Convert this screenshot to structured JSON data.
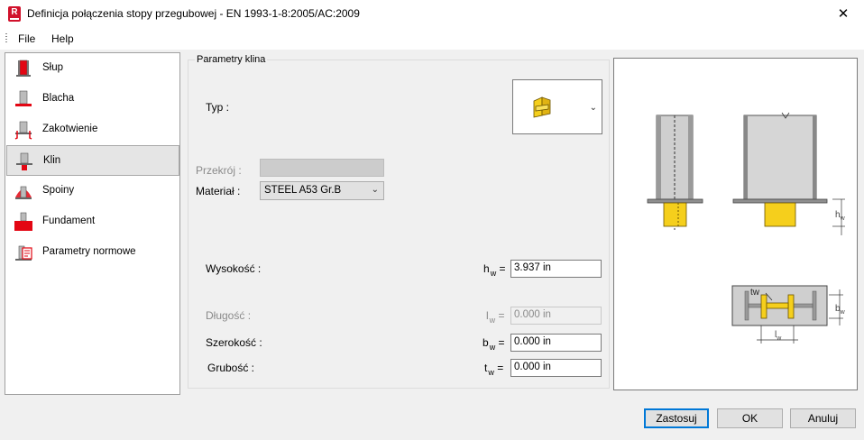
{
  "window": {
    "title": "Definicja połączenia stopy przegubowej - EN 1993-1-8:2005/AC:2009",
    "close_glyph": "✕",
    "app_icon_letter": "R"
  },
  "menu": [
    {
      "label": "File"
    },
    {
      "label": "Help"
    }
  ],
  "sidebar": {
    "items": [
      {
        "label": "Słup",
        "icon": "column-icon"
      },
      {
        "label": "Blacha",
        "icon": "plate-icon"
      },
      {
        "label": "Zakotwienie",
        "icon": "anchor-icon"
      },
      {
        "label": "Klin",
        "icon": "wedge-icon",
        "active": true
      },
      {
        "label": "Spoiny",
        "icon": "weld-icon"
      },
      {
        "label": "Fundament",
        "icon": "foundation-icon"
      },
      {
        "label": "Parametry normowe",
        "icon": "code-params-icon"
      }
    ]
  },
  "group": {
    "title": "Parametry klina",
    "typ_label": "Typ :",
    "typ_icon": "wedge-type-icon",
    "przekroj_label": "Przekrój :",
    "material_label": "Materiał :",
    "material_value": "STEEL A53 Gr.B",
    "fields": [
      {
        "label": "Wysokość :",
        "symbol": "h",
        "sub": "w",
        "eq": "=",
        "value": "3.937 in",
        "enabled": true
      },
      {
        "label": "Długość :",
        "symbol": "l",
        "sub": "w",
        "eq": "=",
        "value": "0.000 in",
        "enabled": false
      },
      {
        "label": "Szerokość :",
        "symbol": "b",
        "sub": "w",
        "eq": "=",
        "value": "0.000 in",
        "enabled": true
      },
      {
        "label": "Grubość :",
        "symbol": "t",
        "sub": "w",
        "eq": "=",
        "value": "0.000 in",
        "enabled": true
      }
    ]
  },
  "preview": {
    "dim_labels": {
      "hw": "h",
      "hw_sub": "w",
      "bw": "b",
      "bw_sub": "w",
      "lw": "l",
      "lw_sub": "w",
      "tw": "tw"
    }
  },
  "buttons": {
    "apply": "Zastosuj",
    "ok": "OK",
    "cancel": "Anuluj"
  },
  "colors": {
    "accent_red": "#e30613",
    "wedge_yellow": "#f5cf1c",
    "focus_blue": "#0078d7"
  }
}
